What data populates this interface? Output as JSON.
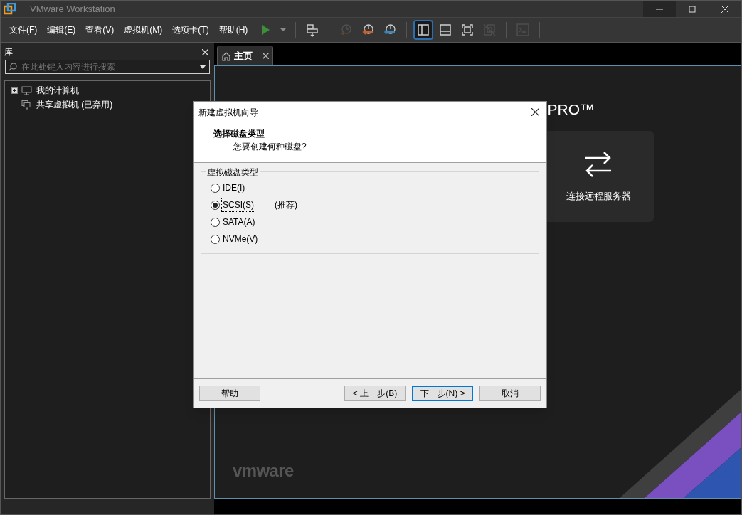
{
  "window": {
    "title": "VMware Workstation"
  },
  "menu": [
    "文件(F)",
    "编辑(E)",
    "查看(V)",
    "虚拟机(M)",
    "选项卡(T)",
    "帮助(H)"
  ],
  "toolbar": [
    {
      "kind": "play"
    },
    {
      "kind": "dropdown"
    },
    {
      "kind": "sep"
    },
    {
      "kind": "send"
    },
    {
      "kind": "sep"
    },
    {
      "kind": "snapshot",
      "disabled": true
    },
    {
      "kind": "revert",
      "disabled": false
    },
    {
      "kind": "manage",
      "disabled": false
    },
    {
      "kind": "sep"
    },
    {
      "kind": "library",
      "selected": true
    },
    {
      "kind": "thumbnail",
      "selected": false
    },
    {
      "kind": "fullscreen",
      "selected": false
    },
    {
      "kind": "unity",
      "disabled": true
    },
    {
      "kind": "sep"
    },
    {
      "kind": "console",
      "disabled": true
    },
    {
      "kind": "sep"
    }
  ],
  "library": {
    "title": "库",
    "search": {
      "placeholder": "在此处键入内容进行搜索"
    },
    "items": [
      {
        "label": "我的计算机",
        "kind": "computer",
        "expandable": true
      },
      {
        "label": "共享虚拟机 (已弃用)",
        "kind": "shared",
        "expandable": false
      }
    ]
  },
  "tabs": [
    {
      "label": "主页",
      "selected": true
    }
  ],
  "home": {
    "brand": "PRO™",
    "card": {
      "label": "连接远程服务器"
    },
    "logo": "vmware"
  },
  "dialog": {
    "title": "新建虚拟机向导",
    "heading": "选择磁盘类型",
    "subheading": "您要创建何种磁盘?",
    "group": {
      "title": "虚拟磁盘类型",
      "options": [
        {
          "label": "IDE(I)",
          "selected": false
        },
        {
          "label": "SCSI(S)",
          "selected": true,
          "note": "(推荐)"
        },
        {
          "label": "SATA(A)",
          "selected": false
        },
        {
          "label": "NVMe(V)",
          "selected": false
        }
      ]
    },
    "buttons": [
      {
        "label": "帮助",
        "kind": "help"
      },
      {
        "label": "< 上一步(B)",
        "kind": "back"
      },
      {
        "label": "下一步(N) >",
        "kind": "next",
        "default": true
      },
      {
        "label": "取消",
        "kind": "cancel"
      }
    ]
  }
}
